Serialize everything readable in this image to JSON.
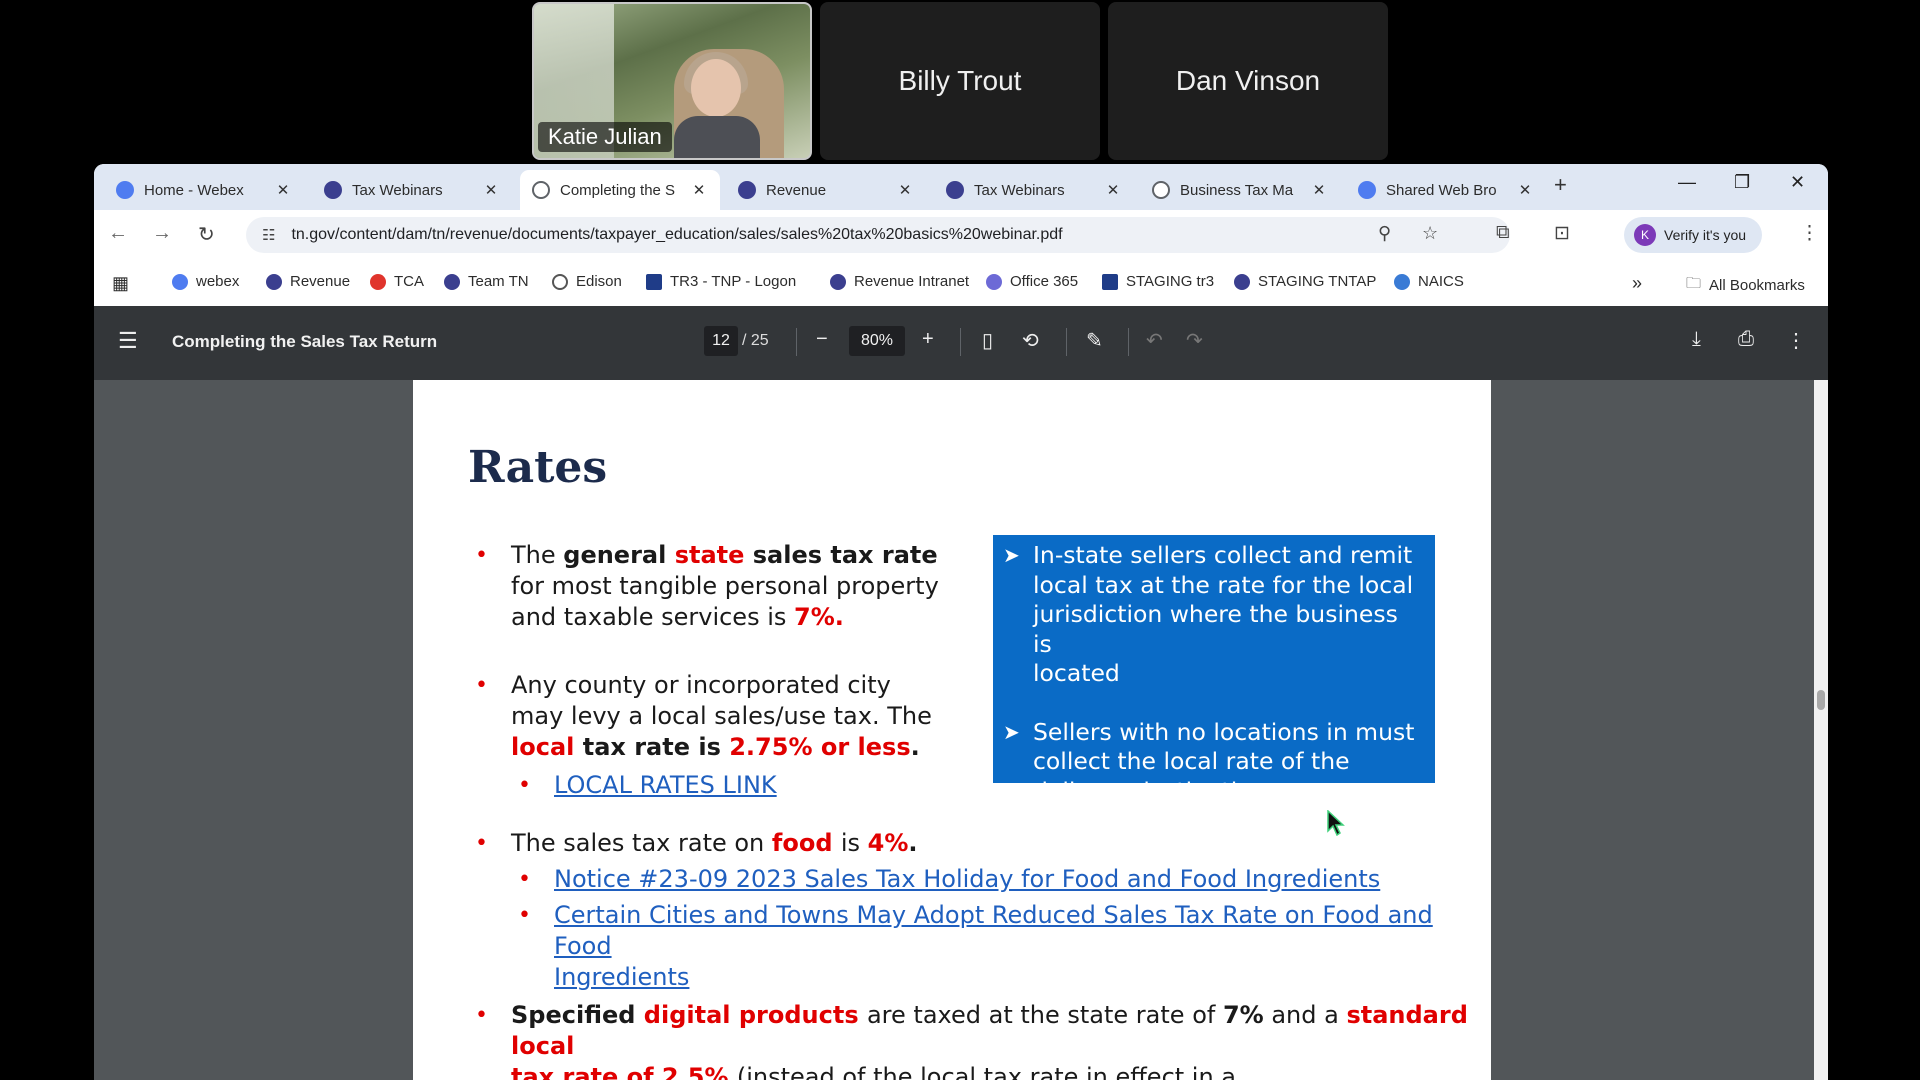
{
  "participants": [
    {
      "name": "Katie Julian",
      "has_video": true
    },
    {
      "name": "Billy Trout",
      "has_video": false
    },
    {
      "name": "Dan Vinson",
      "has_video": false
    }
  ],
  "tabs": [
    {
      "title": "Home - Webex",
      "icon": "webex-icon",
      "color": "#4f7cf0"
    },
    {
      "title": "Tax Webinars",
      "icon": "tn-seal-icon",
      "color": "#3b3f8f"
    },
    {
      "title": "Completing the S",
      "icon": "globe-icon",
      "color": "#5f6368",
      "active": true
    },
    {
      "title": "Revenue",
      "icon": "tn-seal-icon",
      "color": "#3b3f8f"
    },
    {
      "title": "Tax Webinars",
      "icon": "tn-seal-icon",
      "color": "#3b3f8f"
    },
    {
      "title": "Business Tax Ma",
      "icon": "globe-icon",
      "color": "#5f6368"
    },
    {
      "title": "Shared Web Bro",
      "icon": "webex-icon",
      "color": "#4f7cf0"
    }
  ],
  "address": {
    "url": "tn.gov/content/dam/tn/revenue/documents/taxpayer_education/sales/sales%20tax%20basics%20webinar.pdf"
  },
  "profile": {
    "label": "Verify it's you",
    "initial": "K"
  },
  "bookmarks": [
    {
      "label": "webex",
      "color": "#4f7cf0"
    },
    {
      "label": "Revenue",
      "color": "#3b3f8f"
    },
    {
      "label": "TCA",
      "color": "#e0342c"
    },
    {
      "label": "Team TN",
      "color": "#3b3f8f"
    },
    {
      "label": "Edison",
      "color": "#555"
    },
    {
      "label": "TR3 - TNP - Logon",
      "color": "#1f3c88"
    },
    {
      "label": "Revenue Intranet",
      "color": "#3b3f8f"
    },
    {
      "label": "Office 365",
      "color": "#6d6ad6"
    },
    {
      "label": "STAGING tr3",
      "color": "#1f3c88"
    },
    {
      "label": "STAGING TNTAP",
      "color": "#3b3f8f"
    },
    {
      "label": "NAICS",
      "color": "#3a7bd5"
    }
  ],
  "all_bookmarks_label": "All Bookmarks",
  "pdf": {
    "title": "Completing the Sales Tax Return",
    "page": "12",
    "total": "/ 25",
    "zoom": "80%"
  },
  "slide": {
    "heading": "Rates",
    "b1": {
      "t1": "The ",
      "t2": "general ",
      "t3": "state ",
      "t4": "sales tax rate",
      "t5": "for most tangible personal property",
      "t6": "and taxable services is ",
      "t7": "7%."
    },
    "b2": {
      "t1": "Any county or incorporated city",
      "t2": "may levy a local sales/use tax.  The",
      "t3": "local ",
      "t4": "tax rate is ",
      "t5": "2.75% or less",
      "t6": "."
    },
    "link_local": "LOCAL RATES LINK",
    "b3": {
      "t1": "The sales tax rate on ",
      "t2": "food ",
      "t3": "is ",
      "t4": "4%",
      "t5": "."
    },
    "link_notice": "Notice #23-09 2023 Sales Tax Holiday for Food and Food Ingredients",
    "link_cities_1": "Certain Cities and Towns May Adopt Reduced Sales Tax Rate on Food and Food",
    "link_cities_2": "Ingredients",
    "b4": {
      "t1": "Specified ",
      "t2": "digital products ",
      "t3": "are taxed at the state rate of ",
      "t4": "7%",
      "t5": " and a ",
      "t6": "standard local",
      "t7": "tax rate of 2.5% ",
      "t8": "(instead of the local tax rate in effect in a county/municipality)."
    },
    "callout": [
      {
        "l1": "In-state sellers collect and remit",
        "l2": "local tax at the rate for the local",
        "l3": "jurisdiction where the business is",
        "l4": "located"
      },
      {
        "l1": "Sellers with no locations in must",
        "l2": "collect the local rate of the",
        "l3": "delivery destination."
      }
    ]
  }
}
